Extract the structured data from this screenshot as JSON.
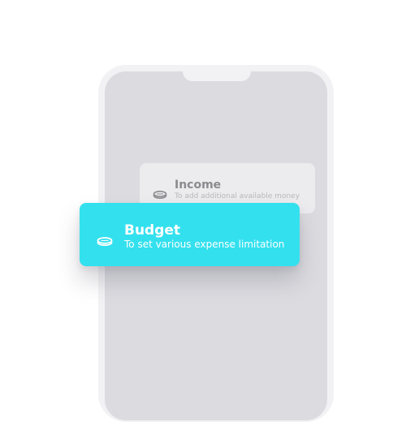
{
  "colors": {
    "accent": "#33e0ee",
    "screen": "#dcdce0",
    "frame": "#f2f2f4"
  },
  "income_card": {
    "icon": "coin-icon",
    "title": "Income",
    "description": "To add additional available money"
  },
  "budget_card": {
    "icon": "coin-icon",
    "title": "Budget",
    "description": "To set various expense limitation"
  }
}
